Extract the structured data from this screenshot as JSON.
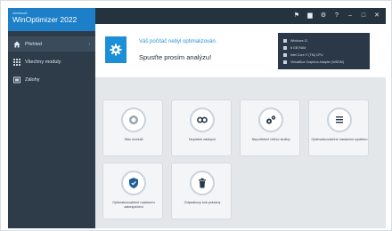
{
  "app": {
    "logo_small": "Abelssoft",
    "logo_title": "WinOptimizer 2022"
  },
  "sidebar": {
    "items": [
      {
        "label": "Přehled",
        "icon": "home-icon"
      },
      {
        "label": "Všechny moduly",
        "icon": "grid-icon"
      },
      {
        "label": "Zálohy",
        "icon": "backup-icon"
      }
    ]
  },
  "topbar": {
    "icons": [
      "flag-icon",
      "save-icon",
      "gear-icon",
      "help-icon",
      "minimize-icon",
      "restore-icon",
      "close-icon"
    ],
    "glyphs": [
      "⚑",
      "▆",
      "⚙",
      "?",
      "–",
      "□",
      "✕"
    ]
  },
  "banner": {
    "title": "Váš počítač nebyl optimalizován.",
    "subtitle": "Spusťte prosím analýzu!",
    "icon": "gear-icon",
    "accent": "#1c8fd6"
  },
  "system_info": [
    "Windows 11",
    "8 GB RAM",
    "Intel Core i7 (TM) CPU",
    "VirtualBox Graphics Adapter (WDDM)"
  ],
  "modules": [
    {
      "label": "Stav modulů",
      "icon": "cpu-icon",
      "color": "#8a96a2"
    },
    {
      "label": "Neplatné zástupci",
      "icon": "link-icon",
      "color": "#2a3848"
    },
    {
      "label": "Nepotřebné běžící služby",
      "icon": "gears-icon",
      "color": "#2a3848"
    },
    {
      "label": "Optimalizovatelné nastavení systému",
      "icon": "settings-list-icon",
      "color": "#2a3848"
    },
    {
      "label": "Optimalizovatelné nastavení zabezpečení",
      "icon": "shield-icon",
      "color": "#1e5f9a"
    },
    {
      "label": "Odpadkový koš prázdný",
      "icon": "trash-icon",
      "color": "#2a3848"
    }
  ]
}
